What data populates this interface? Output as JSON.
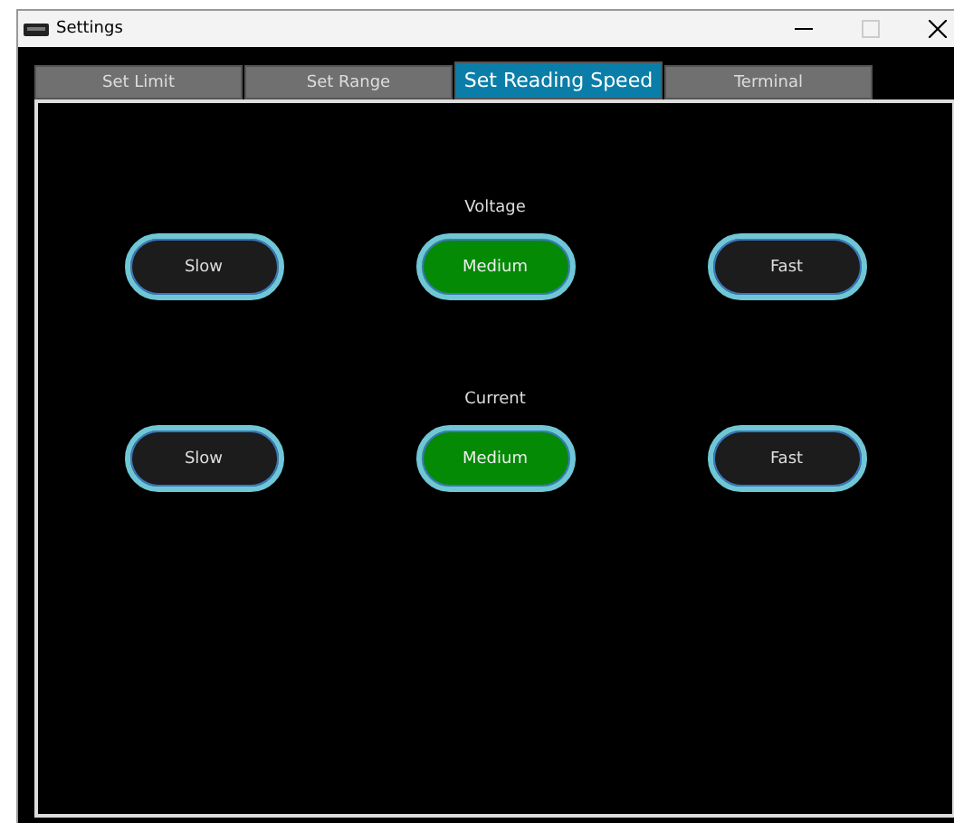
{
  "window": {
    "title": "Settings"
  },
  "tabs": [
    {
      "label": "Set Limit",
      "selected": false
    },
    {
      "label": "Set Range",
      "selected": false
    },
    {
      "label": "Set Reading Speed",
      "selected": true
    },
    {
      "label": "Terminal",
      "selected": false
    }
  ],
  "groups": [
    {
      "label": "Voltage",
      "options": [
        {
          "label": "Slow",
          "selected": false
        },
        {
          "label": "Medium",
          "selected": true
        },
        {
          "label": "Fast",
          "selected": false
        }
      ]
    },
    {
      "label": "Current",
      "options": [
        {
          "label": "Slow",
          "selected": false
        },
        {
          "label": "Medium",
          "selected": true
        },
        {
          "label": "Fast",
          "selected": false
        }
      ]
    }
  ]
}
